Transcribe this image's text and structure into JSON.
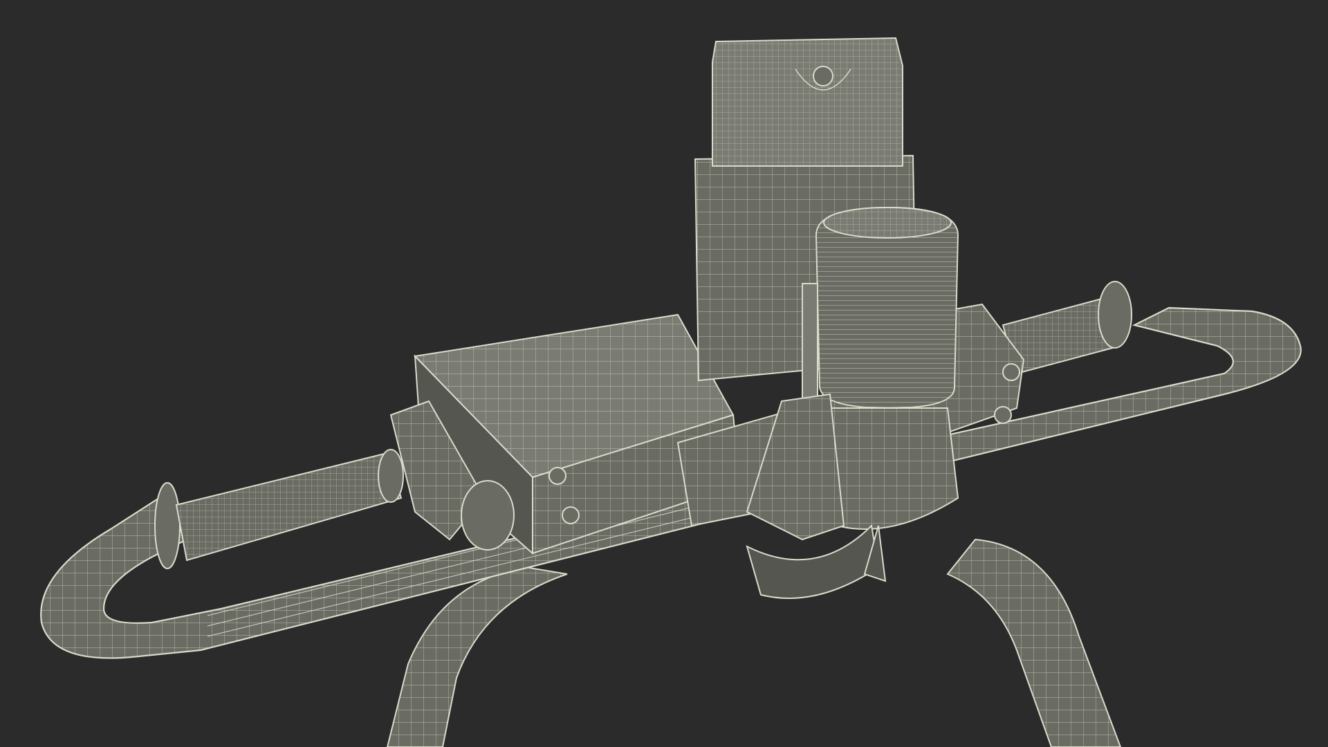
{
  "viewport": {
    "background": "#2b2b2b",
    "mesh_fill": "#6a6b63",
    "mesh_fill_light": "#7a7b72",
    "mesh_fill_dark": "#55564f",
    "wire_color": "#d8dccb"
  },
  "model": {
    "subject": "portable-auger-powerhead-wireframe",
    "parts": [
      "handlebar-frame",
      "left-grip",
      "right-grip",
      "gearbox-housing",
      "fuel-tank",
      "engine-cylinder",
      "spark-plug",
      "support-legs"
    ]
  }
}
